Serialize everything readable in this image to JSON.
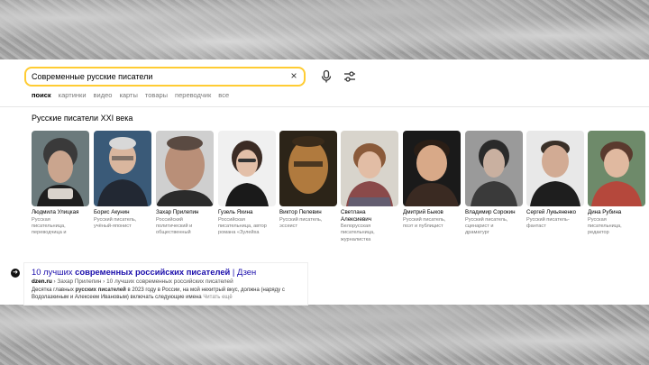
{
  "search": {
    "query": "Современные русские писатели",
    "clear_icon": "×"
  },
  "tabs": [
    {
      "label": "поиск",
      "active": true
    },
    {
      "label": "картинки"
    },
    {
      "label": "видео"
    },
    {
      "label": "карты"
    },
    {
      "label": "товары"
    },
    {
      "label": "переводчик"
    },
    {
      "label": "все"
    }
  ],
  "carousel": {
    "title": "Русские писатели XXI века",
    "people": [
      {
        "name": "Людмила Улицкая",
        "desc": "Русская\nписательница,\nпереводчица и"
      },
      {
        "name": "Борис Акунин",
        "desc": "Русский писатель,\nучёный-японист"
      },
      {
        "name": "Захар Прилепин",
        "desc": "Российский\nполитический и\nобщественный"
      },
      {
        "name": "Гузель Яхина",
        "desc": "Российская\nписательница, автор\nромана «Зулейха"
      },
      {
        "name": "Виктор Пелевин",
        "desc": "Русский писатель,\nэссеист"
      },
      {
        "name": "Светлана\nАлексиевич",
        "desc": "Белорусская\nписательница,\nжурналистка"
      },
      {
        "name": "Дмитрий Быков",
        "desc": "Русский писатель,\nпоэт и публицист"
      },
      {
        "name": "Владимир Сорокин",
        "desc": "Русский писатель,\nсценарист и\nдраматург"
      },
      {
        "name": "Сергей Лукьяненко",
        "desc": "Русский писатель-\nфантаст"
      },
      {
        "name": "Дина Рубина",
        "desc": "Русская\nписательница,\nредактор"
      }
    ]
  },
  "result": {
    "title_plain": "10 лучших ",
    "title_bold": "современных российских писателей",
    "title_tail": " | Дзен",
    "url_domain": "dzen.ru",
    "url_path": " › Захар Прилепин › 10 лучших современных российских писателей",
    "snippet_1": "Десятка главных ",
    "snippet_bold": "русских писателей",
    "snippet_2": " в 2023 году в России, на мой нехитрый вкус, должна (наряду с Водолазкиным и Алексеем Ивановым) включать следующие имена ",
    "read_more": "Читать ещё"
  },
  "colors": {
    "search_border": "#ffcc33",
    "link": "#1a0dab",
    "url": "#006621"
  }
}
